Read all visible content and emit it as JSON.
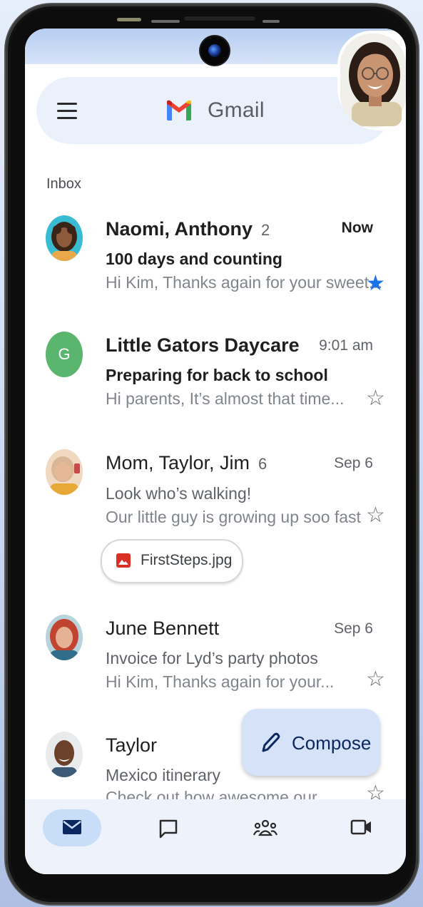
{
  "header": {
    "app_name": "Gmail",
    "menu_icon": "hamburger-menu-icon",
    "logo_icon": "gmail-logo-icon",
    "account_avatar": "profile-avatar"
  },
  "inbox_label": "Inbox",
  "emails": [
    {
      "sender": "Naomi, Anthony",
      "count": "2",
      "time": "Now",
      "subject": "100 days and counting",
      "snippet": "Hi Kim, Thanks again for your sweet...",
      "unread": true,
      "starred": true,
      "avatar": "photo-avatar"
    },
    {
      "sender": "Little Gators Daycare",
      "count": "",
      "time": "9:01 am",
      "subject": "Preparing for back to school",
      "snippet": "Hi parents, It’s almost that time...",
      "unread": true,
      "starred": false,
      "avatar_letter": "G",
      "avatar_color": "#5ab56f"
    },
    {
      "sender": "Mom, Taylor, Jim",
      "count": "6",
      "time": "Sep 6",
      "subject": "Look who’s walking!",
      "snippet": "Our little guy is growing up soo fast",
      "unread": false,
      "starred": false,
      "attachment": "FirstSteps.jpg",
      "avatar": "photo-avatar"
    },
    {
      "sender": "June Bennett",
      "count": "",
      "time": "Sep 6",
      "subject": "Invoice for Lyd’s party photos",
      "snippet": "Hi Kim, Thanks again for your...",
      "unread": false,
      "starred": false,
      "avatar": "photo-avatar"
    },
    {
      "sender": "Taylor",
      "count": "",
      "time": "",
      "subject": "Mexico itinerary",
      "snippet": "Check out how awesome our",
      "unread": false,
      "starred": false,
      "avatar": "photo-avatar"
    }
  ],
  "compose": {
    "label": "Compose",
    "icon": "pencil-icon"
  },
  "bottom_nav": [
    {
      "icon": "mail-icon",
      "active": true
    },
    {
      "icon": "chat-icon",
      "active": false
    },
    {
      "icon": "spaces-icon",
      "active": false
    },
    {
      "icon": "video-icon",
      "active": false
    }
  ],
  "colors": {
    "accent_blue": "#1a73e8",
    "compose_bg": "#d5e2f8",
    "nav_active": "#c7ddf8",
    "search_bg": "#eaf1fb"
  }
}
